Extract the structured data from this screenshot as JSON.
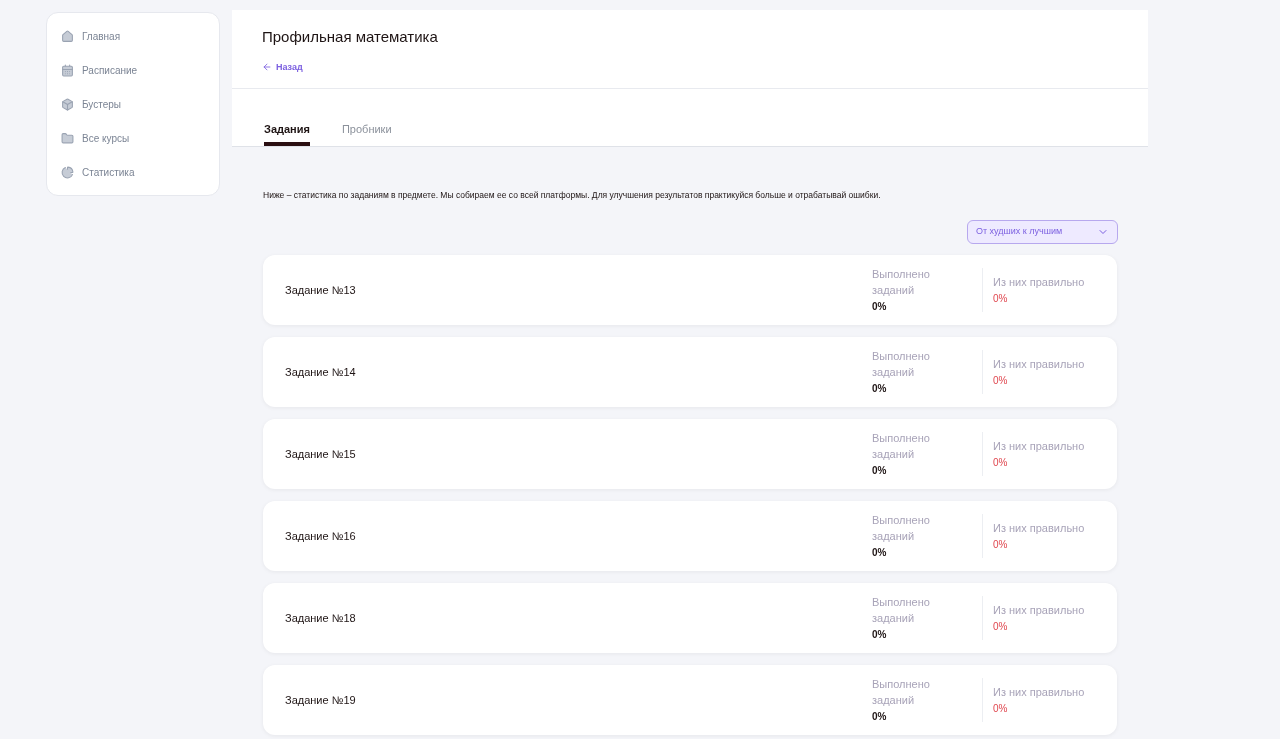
{
  "sidebar": {
    "items": [
      {
        "kind": "home",
        "label": "Главная"
      },
      {
        "kind": "calendar",
        "label": "Расписание"
      },
      {
        "kind": "cube",
        "label": "Бустеры"
      },
      {
        "kind": "folder",
        "label": "Все курсы"
      },
      {
        "kind": "chart",
        "label": "Статистика"
      }
    ]
  },
  "header": {
    "title": "Профильная математика",
    "back": "Назад"
  },
  "tabs": [
    {
      "label": "Задания",
      "selected": true
    },
    {
      "label": "Пробники",
      "selected": false
    }
  ],
  "intro": "Ниже – статистика по заданиям в предмете. Мы собираем ее со всей платформы. Для улучшения результатов практикуйся больше и отрабатывай ошибки.",
  "sort": {
    "value": "От худших к лучшим"
  },
  "tasks": [
    {
      "name": "Задание №13",
      "done_label": "Выполнено заданий",
      "done": "0%",
      "correct_label": "Из них правильно",
      "correct": "0%"
    },
    {
      "name": "Задание №14",
      "done_label": "Выполнено заданий",
      "done": "0%",
      "correct_label": "Из них правильно",
      "correct": "0%"
    },
    {
      "name": "Задание №15",
      "done_label": "Выполнено заданий",
      "done": "0%",
      "correct_label": "Из них правильно",
      "correct": "0%"
    },
    {
      "name": "Задание №16",
      "done_label": "Выполнено заданий",
      "done": "0%",
      "correct_label": "Из них правильно",
      "correct": "0%"
    },
    {
      "name": "Задание №18",
      "done_label": "Выполнено заданий",
      "done": "0%",
      "correct_label": "Из них правильно",
      "correct": "0%"
    },
    {
      "name": "Задание №19",
      "done_label": "Выполнено заданий",
      "done": "0%",
      "correct_label": "Из них правильно",
      "correct": "0%"
    }
  ]
}
